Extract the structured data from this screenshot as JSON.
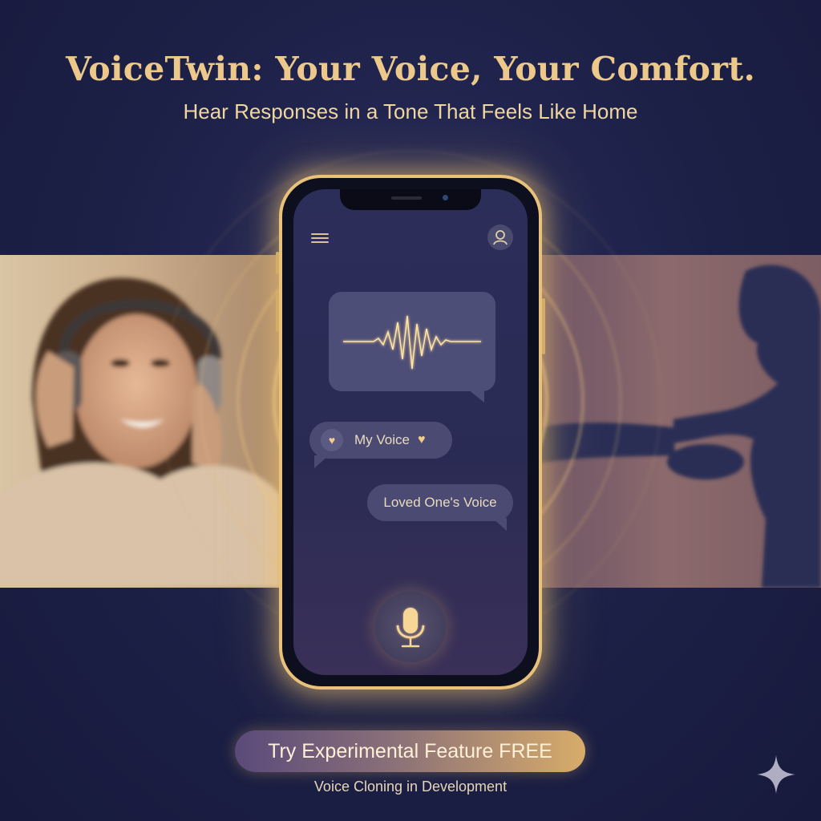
{
  "header": {
    "title": "VoiceTwin: Your Voice, Your Comfort.",
    "subtitle": "Hear Responses in a Tone That Feels Like Home"
  },
  "phone": {
    "menu_icon": "hamburger-menu-icon",
    "profile_icon": "user-profile-icon",
    "waveform_icon": "audio-waveform-icon",
    "chips": {
      "my_voice": "My Voice",
      "loved_one": "Loved One's Voice"
    },
    "heart_icon": "heart-icon",
    "mic_icon": "microphone-icon"
  },
  "cta": {
    "label": "Try Experimental Feature FREE",
    "note": "Voice Cloning in Development"
  },
  "colors": {
    "background": "#1d2148",
    "accent_gold": "#ecc98a",
    "bubble": "#4a4a72"
  },
  "decor": {
    "sparkle_icon": "sparkle-icon"
  }
}
